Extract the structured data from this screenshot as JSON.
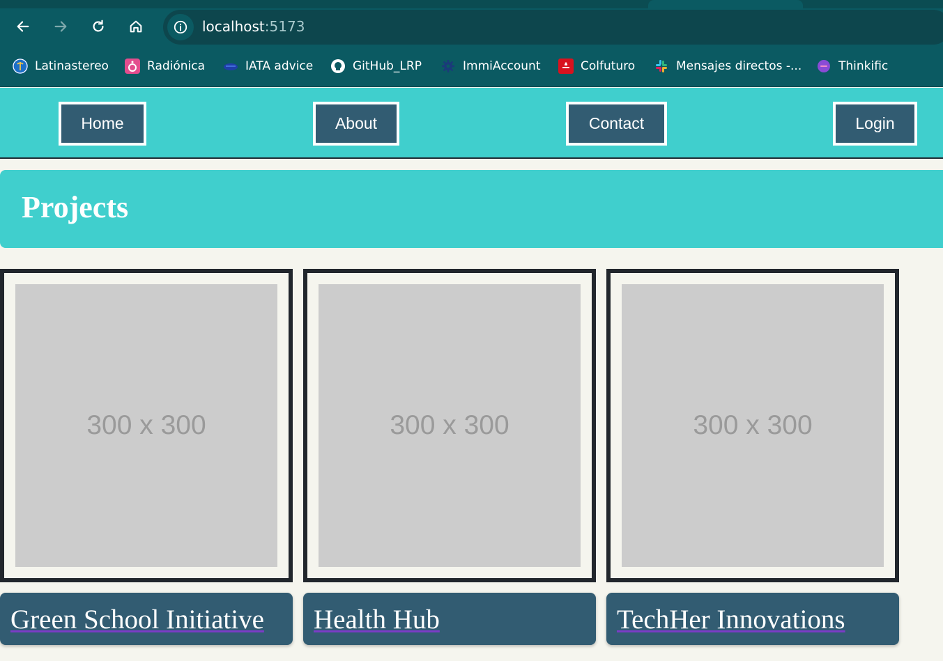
{
  "browser": {
    "url_host": "localhost",
    "url_port": ":5173",
    "bookmarks": [
      {
        "label": "Latinastereo",
        "icon": "latinastereo-icon"
      },
      {
        "label": "Radiónica",
        "icon": "radionica-icon"
      },
      {
        "label": "IATA advice",
        "icon": "iata-icon"
      },
      {
        "label": "GitHub_LRP",
        "icon": "github-icon"
      },
      {
        "label": "ImmiAccount",
        "icon": "immiaccount-icon"
      },
      {
        "label": "Colfuturo",
        "icon": "colfuturo-icon"
      },
      {
        "label": "Mensajes directos -...",
        "icon": "slack-icon"
      },
      {
        "label": "Thinkific",
        "icon": "thinkific-icon"
      }
    ]
  },
  "nav": {
    "home": "Home",
    "about": "About",
    "contact": "Contact",
    "login": "Login"
  },
  "projects": {
    "title": "Projects",
    "items": [
      {
        "image_text": "300 x 300",
        "title": "Green School Initiative"
      },
      {
        "image_text": "300 x 300",
        "title": "Health Hub"
      },
      {
        "image_text": "300 x 300",
        "title": "TechHer Innovations"
      }
    ]
  },
  "colors": {
    "accent_teal": "#40cfcd",
    "button_blue": "#325c72",
    "chrome_teal": "#0b5a62",
    "background": "#f5f5ee"
  }
}
